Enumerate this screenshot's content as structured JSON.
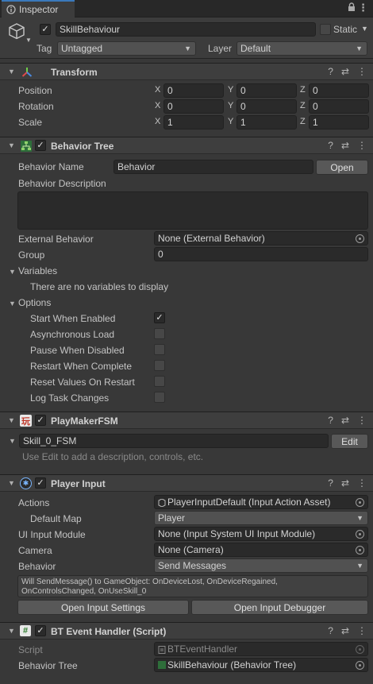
{
  "tab": {
    "title": "Inspector"
  },
  "gameobject": {
    "active": true,
    "name": "SkillBehaviour",
    "static_label": "Static",
    "tag_label": "Tag",
    "tag_value": "Untagged",
    "layer_label": "Layer",
    "layer_value": "Default"
  },
  "transform": {
    "title": "Transform",
    "rows": [
      {
        "label": "Position",
        "x": "0",
        "y": "0",
        "z": "0"
      },
      {
        "label": "Rotation",
        "x": "0",
        "y": "0",
        "z": "0"
      },
      {
        "label": "Scale",
        "x": "1",
        "y": "1",
        "z": "1"
      }
    ],
    "axis": {
      "x": "X",
      "y": "Y",
      "z": "Z"
    }
  },
  "behavior_tree": {
    "title": "Behavior Tree",
    "name_label": "Behavior Name",
    "name_value": "Behavior",
    "open_label": "Open",
    "desc_label": "Behavior Description",
    "external_label": "External Behavior",
    "external_value": "None (External Behavior)",
    "group_label": "Group",
    "group_value": "0",
    "variables_label": "Variables",
    "no_variables": "There are no variables to display",
    "options_label": "Options",
    "options": [
      {
        "label": "Start When Enabled",
        "checked": true
      },
      {
        "label": "Asynchronous Load",
        "checked": false
      },
      {
        "label": "Pause When Disabled",
        "checked": false
      },
      {
        "label": "Restart When Complete",
        "checked": false
      },
      {
        "label": "Reset Values On Restart",
        "checked": false
      },
      {
        "label": "Log Task Changes",
        "checked": false
      }
    ]
  },
  "playmaker": {
    "title": "PlayMakerFSM",
    "fsm_name": "Skill_0_FSM",
    "edit_label": "Edit",
    "hint": "Use Edit to add a description, controls, etc."
  },
  "player_input": {
    "title": "Player Input",
    "actions_label": "Actions",
    "actions_value": "PlayerInputDefault (Input Action Asset)",
    "default_map_label": "Default Map",
    "default_map_value": "Player",
    "ui_module_label": "UI Input Module",
    "ui_module_value": "None (Input System UI Input Module)",
    "camera_label": "Camera",
    "camera_value": "None (Camera)",
    "behavior_label": "Behavior",
    "behavior_value": "Send Messages",
    "info_line1": "Will SendMessage() to GameObject: OnDeviceLost, OnDeviceRegained,",
    "info_line2": "OnControlsChanged, OnUseSkill_0",
    "open_settings": "Open Input Settings",
    "open_debugger": "Open Input Debugger"
  },
  "bt_event_handler": {
    "title": "BT Event Handler (Script)",
    "script_label": "Script",
    "script_value": "BTEventHandler",
    "tree_label": "Behavior Tree",
    "tree_value": "SkillBehaviour (Behavior Tree)"
  },
  "icons": {
    "tab": "inspector-icon",
    "lock": "lock-icon",
    "menu": "kebab-menu-icon",
    "gameobject": "cube-icon",
    "transform": "transform-axes-icon",
    "help": "help-icon",
    "presets": "presets-icon",
    "picker": "object-picker-icon"
  },
  "colors": {
    "background": "#383838",
    "header": "#3e3e3e",
    "field": "#2a2a2a",
    "tab_accent": "#3a79bb"
  }
}
